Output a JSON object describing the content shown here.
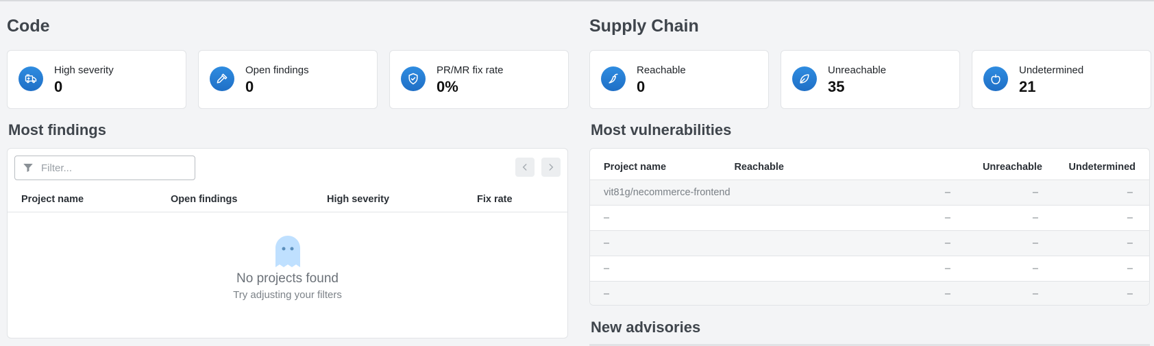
{
  "code": {
    "title": "Code",
    "cards": [
      {
        "label": "High severity",
        "value": "0",
        "icon": "ambulance-icon"
      },
      {
        "label": "Open findings",
        "value": "0",
        "icon": "hammer-icon"
      },
      {
        "label": "PR/MR fix rate",
        "value": "0%",
        "icon": "shield-check-icon"
      }
    ],
    "most_findings": {
      "title": "Most findings",
      "filter_placeholder": "Filter...",
      "columns": [
        "Project name",
        "Open findings",
        "High severity",
        "Fix rate"
      ],
      "empty_title": "No projects found",
      "empty_subtitle": "Try adjusting your filters"
    }
  },
  "supply": {
    "title": "Supply Chain",
    "cards": [
      {
        "label": "Reachable",
        "value": "0",
        "icon": "chili-pepper-icon"
      },
      {
        "label": "Unreachable",
        "value": "35",
        "icon": "leaf-icon"
      },
      {
        "label": "Undetermined",
        "value": "21",
        "icon": "bell-pepper-icon"
      }
    ],
    "most_vulnerabilities": {
      "title": "Most vulnerabilities",
      "columns": [
        "Project name",
        "Reachable",
        "Unreachable",
        "Undetermined"
      ],
      "rows": [
        [
          "vit81g/necommerce-frontend",
          "–",
          "–",
          "–"
        ],
        [
          "–",
          "–",
          "–",
          "–"
        ],
        [
          "–",
          "–",
          "–",
          "–"
        ],
        [
          "–",
          "–",
          "–",
          "–"
        ],
        [
          "–",
          "–",
          "–",
          "–"
        ]
      ]
    },
    "new_advisories_title": "New advisories"
  },
  "colors": {
    "accent": "#1f6fc6",
    "background": "#f3f4f6",
    "ghost": "#bfe0ff"
  }
}
